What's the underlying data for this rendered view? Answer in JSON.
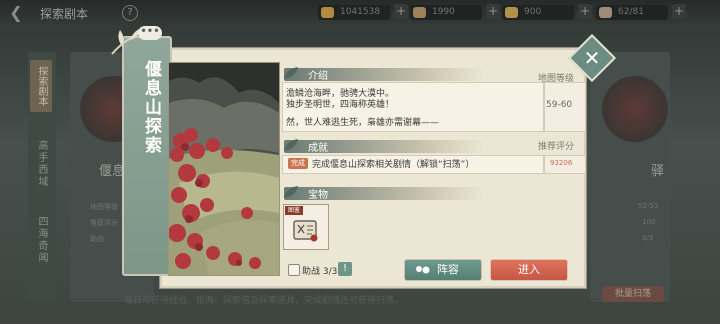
{
  "top_bar": {
    "title": "探索剧本",
    "back_icon": "chevron-left-icon",
    "help": "?",
    "resources": [
      {
        "name": "gold",
        "value": "1041538",
        "color": "#b08c3c"
      },
      {
        "name": "scroll",
        "value": "1990",
        "color": "#9c8458"
      },
      {
        "name": "ingot",
        "value": "900",
        "color": "#b2924a"
      },
      {
        "name": "card",
        "value": "62/81",
        "color": "#a08a7a"
      }
    ]
  },
  "background": {
    "rail_tab": "探索剧本",
    "rail_items": [
      "高手西域",
      "四海奇闻"
    ],
    "cards": [
      {
        "name": "偃息",
        "stats": [
          "地图等级",
          "推荐评分",
          "助战"
        ]
      },
      {
        "name": "驿",
        "stats": [
          "52-53",
          "100",
          "3/3"
        ]
      }
    ],
    "bottom_note": "每日可获得经验、银两、探索值及探索道具，完成剧情还可获得扫荡。",
    "right_button": "批量扫荡"
  },
  "dialog": {
    "title": "偃息山探索",
    "more_button": "•••",
    "close_label": "✕",
    "intro": {
      "header": "介绍",
      "lines": [
        "澹鳞沧海畔，驰骋大漠中。",
        "独步圣明世，四海称英雄！",
        "",
        "然，世人难逃生死，枭雄亦需谢幕——"
      ]
    },
    "map_level": {
      "label": "地图等级",
      "value": "59-60"
    },
    "achievement": {
      "header": "成就",
      "badge": "完成",
      "text": "完成偃息山探索相关剧情（解锁“扫荡”）"
    },
    "recommended_score": {
      "label": "推荐评分",
      "value": "93206"
    },
    "treasure": {
      "header": "宝物",
      "tag": "图鉴",
      "item_icon": "scroll-book-icon"
    },
    "assist": {
      "label": "助战 3/3",
      "info": "!"
    },
    "buttons": {
      "lineup": "阵容",
      "enter": "进入"
    }
  },
  "colors": {
    "panel_bg": "#ece6d4",
    "banner": "#8fa79a",
    "enter_button": "#d4664f",
    "lineup_button": "#62897e",
    "score_value": "#c76c56"
  }
}
